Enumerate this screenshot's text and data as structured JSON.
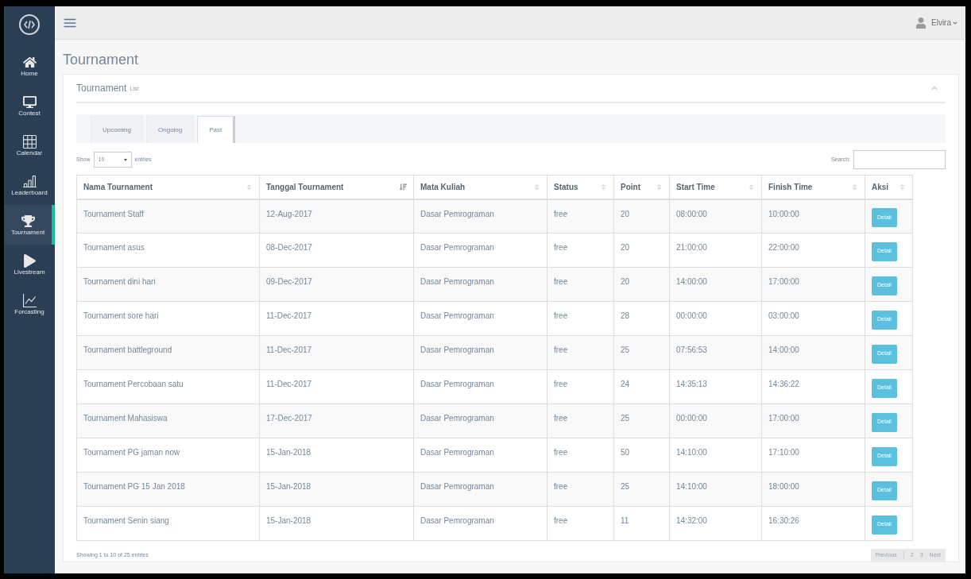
{
  "sidebar": {
    "items": [
      {
        "label": "Home",
        "selected": false
      },
      {
        "label": "Contest",
        "selected": false
      },
      {
        "label": "Calendar",
        "selected": false
      },
      {
        "label": "Leaderboard",
        "selected": false
      },
      {
        "label": "Tournament",
        "selected": true
      },
      {
        "label": "Livestream",
        "selected": false
      },
      {
        "label": "Forcasting",
        "selected": false
      }
    ]
  },
  "topbar": {
    "user": "Elvira"
  },
  "page_title": "Tournament",
  "panel": {
    "title": "Tournament",
    "subtitle": "List"
  },
  "tabs": [
    {
      "label": "Upcoming",
      "selected": false
    },
    {
      "label": "Ongoing",
      "selected": false
    },
    {
      "label": "Past",
      "selected": true
    }
  ],
  "length": {
    "show": "Show",
    "value": "10",
    "entries": "entries"
  },
  "search": {
    "label": "Search:"
  },
  "table": {
    "columns": [
      {
        "label": "Nama Tournament",
        "sorted": false
      },
      {
        "label": "Tanggal Tournament",
        "sorted": true
      },
      {
        "label": "Mata Kuliah",
        "sorted": false
      },
      {
        "label": "Status",
        "sorted": false
      },
      {
        "label": "Point",
        "sorted": false
      },
      {
        "label": "Start Time",
        "sorted": false
      },
      {
        "label": "Finish Time",
        "sorted": false
      },
      {
        "label": "Aksi",
        "sorted": false
      }
    ],
    "rows": [
      {
        "cells": [
          "Tournament Staff",
          "12-Aug-2017",
          "Dasar Pemrograman",
          "free",
          "20",
          "08:00:00",
          "10:00:00"
        ],
        "action": "Detail"
      },
      {
        "cells": [
          "Tournament asus",
          "08-Dec-2017",
          "Dasar Pemrograman",
          "free",
          "20",
          "21:00:00",
          "22:00:00"
        ],
        "action": "Detail"
      },
      {
        "cells": [
          "Tournament dini hari",
          "09-Dec-2017",
          "Dasar Pemrograman",
          "free",
          "20",
          "14:00:00",
          "17:00:00"
        ],
        "action": "Detail"
      },
      {
        "cells": [
          "Tournament sore hari",
          "11-Dec-2017",
          "Dasar Pemrograman",
          "free",
          "28",
          "00:00:00",
          "03:00:00"
        ],
        "action": "Detail"
      },
      {
        "cells": [
          "Tournament battleground",
          "11-Dec-2017",
          "Dasar Pemrograman",
          "free",
          "25",
          "07:56:53",
          "14:00:00"
        ],
        "action": "Detail"
      },
      {
        "cells": [
          "Tournament Percobaan satu",
          "11-Dec-2017",
          "Dasar Pemrograman",
          "free",
          "24",
          "14:35:13",
          "14:36:22"
        ],
        "action": "Detail"
      },
      {
        "cells": [
          "Tournament Mahasiswa",
          "17-Dec-2017",
          "Dasar Pemrograman",
          "free",
          "25",
          "00:00:00",
          "17:00:00"
        ],
        "action": "Detail"
      },
      {
        "cells": [
          "Tournament PG jaman now",
          "15-Jan-2018",
          "Dasar Pemrograman",
          "free",
          "50",
          "14:10:00",
          "17:10:00"
        ],
        "action": "Detail"
      },
      {
        "cells": [
          "Tournament PG 15 Jan 2018",
          "15-Jan-2018",
          "Dasar Pemrograman",
          "free",
          "25",
          "14:10:00",
          "18:00:00"
        ],
        "action": "Detail"
      },
      {
        "cells": [
          "Tournament Senin siang",
          "15-Jan-2018",
          "Dasar Pemrograman",
          "free",
          "11",
          "14:32:00",
          "16:30:26"
        ],
        "action": "Detail"
      }
    ]
  },
  "info": "Showing 1 to 10 of 25 entries",
  "pagination": {
    "previous": "Previous",
    "pages": [
      "2",
      "3"
    ],
    "next": "Next"
  }
}
